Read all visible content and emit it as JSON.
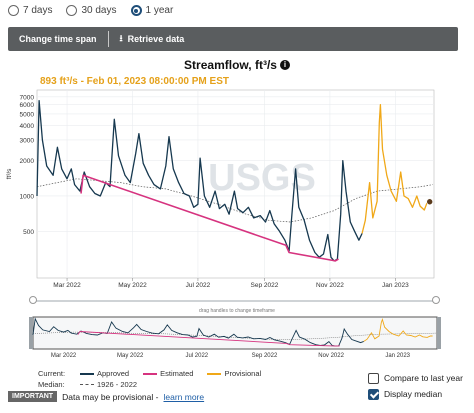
{
  "period_options": [
    {
      "label": "7 days",
      "selected": false
    },
    {
      "label": "30 days",
      "selected": false
    },
    {
      "label": "1 year",
      "selected": true
    }
  ],
  "toolbar": {
    "change_time_span": "Change time span",
    "retrieve_data": "Retrieve data"
  },
  "chart": {
    "title": "Streamflow, ft³/s",
    "readout": "893 ft³/s - Feb 01, 2023 08:00:00 PM EST"
  },
  "drag_hint": "drag handles to change timeframe",
  "legend": {
    "current_label": "Current:",
    "median_label": "Median:",
    "approved": "Approved",
    "estimated": "Estimated",
    "provisional": "Provisional",
    "median_range": "1926 - 2022"
  },
  "options": {
    "compare_label": "Compare to last year",
    "compare_checked": false,
    "median_label": "Display median",
    "median_checked": true
  },
  "notice": {
    "badge": "IMPORTANT",
    "text": "Data may be provisional -",
    "link": "learn more"
  },
  "colors": {
    "approved": "#16384f",
    "estimated": "#d6337f",
    "provisional": "#f0a818",
    "median": "#555555"
  },
  "watermark": {
    "text": "USGS"
  },
  "chart_data": {
    "type": "line",
    "title": "Streamflow, ft³/s",
    "ylabel": "ft³/s",
    "y_scale": "log",
    "ylim": [
      200,
      8000
    ],
    "y_ticks": [
      500,
      1000,
      2000,
      3000,
      4000,
      5000,
      6000,
      7000
    ],
    "x_ticks": [
      "Mar 2022",
      "May 2022",
      "Jul 2022",
      "Sep 2022",
      "Nov 2022",
      "Jan 2023"
    ],
    "x_ticks_iso": [
      "2022-03-01",
      "2022-05-01",
      "2022-07-01",
      "2022-09-01",
      "2022-11-01",
      "2023-01-01"
    ],
    "xlim": [
      "2022-02-01",
      "2023-02-06"
    ],
    "grid": true,
    "legend_position": "bottom-left",
    "series": [
      {
        "name": "Approved",
        "points": [
          [
            "2022-02-01",
            1000
          ],
          [
            "2022-02-03",
            6500
          ],
          [
            "2022-02-06",
            3000
          ],
          [
            "2022-02-10",
            1800
          ],
          [
            "2022-02-16",
            1500
          ],
          [
            "2022-02-20",
            2600
          ],
          [
            "2022-02-24",
            1700
          ],
          [
            "2022-03-01",
            1400
          ],
          [
            "2022-03-05",
            1700
          ],
          [
            "2022-03-08",
            1250
          ],
          [
            "2022-03-13",
            1100
          ],
          [
            "2022-03-17",
            1600
          ],
          [
            "2022-03-22",
            1200
          ],
          [
            "2022-03-27",
            1050
          ],
          [
            "2022-04-01",
            1000
          ],
          [
            "2022-04-06",
            1300
          ],
          [
            "2022-04-10",
            1200
          ],
          [
            "2022-04-14",
            4500
          ],
          [
            "2022-04-18",
            2200
          ],
          [
            "2022-04-24",
            1500
          ],
          [
            "2022-04-29",
            1300
          ],
          [
            "2022-05-04",
            2300
          ],
          [
            "2022-05-07",
            3400
          ],
          [
            "2022-05-11",
            1900
          ],
          [
            "2022-05-16",
            1500
          ],
          [
            "2022-05-21",
            1250
          ],
          [
            "2022-05-27",
            1150
          ],
          [
            "2022-06-01",
            1800
          ],
          [
            "2022-06-04",
            3200
          ],
          [
            "2022-06-08",
            1700
          ],
          [
            "2022-06-13",
            1300
          ],
          [
            "2022-06-18",
            1050
          ],
          [
            "2022-06-23",
            1000
          ],
          [
            "2022-06-27",
            800
          ],
          [
            "2022-07-01",
            850
          ],
          [
            "2022-07-03",
            2100
          ],
          [
            "2022-07-07",
            1000
          ],
          [
            "2022-07-12",
            800
          ],
          [
            "2022-07-17",
            1100
          ],
          [
            "2022-07-21",
            780
          ],
          [
            "2022-07-26",
            850
          ],
          [
            "2022-07-30",
            700
          ],
          [
            "2022-08-04",
            1100
          ],
          [
            "2022-08-07",
            780
          ],
          [
            "2022-08-12",
            720
          ],
          [
            "2022-08-17",
            800
          ],
          [
            "2022-08-22",
            650
          ],
          [
            "2022-08-28",
            680
          ],
          [
            "2022-09-02",
            600
          ],
          [
            "2022-09-06",
            750
          ],
          [
            "2022-09-10",
            580
          ],
          [
            "2022-09-15",
            500
          ],
          [
            "2022-09-20",
            420
          ],
          [
            "2022-09-24",
            340
          ],
          [
            "2022-09-26",
            600
          ],
          [
            "2022-09-30",
            1700
          ],
          [
            "2022-10-03",
            800
          ],
          [
            "2022-10-08",
            620
          ],
          [
            "2022-10-13",
            420
          ],
          [
            "2022-10-18",
            330
          ],
          [
            "2022-10-22",
            300
          ],
          [
            "2022-10-26",
            320
          ],
          [
            "2022-10-30",
            470
          ],
          [
            "2022-11-02",
            300
          ],
          [
            "2022-11-05",
            280
          ],
          [
            "2022-11-08",
            290
          ],
          [
            "2022-11-11",
            700
          ],
          [
            "2022-11-13",
            2000
          ],
          [
            "2022-11-16",
            1100
          ],
          [
            "2022-11-20",
            600
          ],
          [
            "2022-11-24",
            500
          ],
          [
            "2022-11-28",
            420
          ],
          [
            "2022-12-01",
            480
          ]
        ]
      },
      {
        "name": "Estimated",
        "points": [
          [
            "2022-03-14",
            1050
          ],
          [
            "2022-03-16",
            1500
          ],
          [
            "2022-09-21",
            380
          ],
          [
            "2022-09-24",
            330
          ],
          [
            "2022-11-06",
            280
          ],
          [
            "2022-11-09",
            290
          ]
        ]
      },
      {
        "name": "Provisional",
        "points": [
          [
            "2022-12-01",
            480
          ],
          [
            "2022-12-04",
            620
          ],
          [
            "2022-12-08",
            1300
          ],
          [
            "2022-12-11",
            650
          ],
          [
            "2022-12-15",
            900
          ],
          [
            "2022-12-17",
            4200
          ],
          [
            "2022-12-18",
            6000
          ],
          [
            "2022-12-20",
            2500
          ],
          [
            "2022-12-24",
            1500
          ],
          [
            "2022-12-28",
            1100
          ],
          [
            "2023-01-02",
            900
          ],
          [
            "2023-01-06",
            1600
          ],
          [
            "2023-01-09",
            1000
          ],
          [
            "2023-01-13",
            950
          ],
          [
            "2023-01-17",
            800
          ],
          [
            "2023-01-21",
            1000
          ],
          [
            "2023-01-24",
            820
          ],
          [
            "2023-01-28",
            760
          ],
          [
            "2023-01-31",
            900
          ],
          [
            "2023-02-02",
            893
          ]
        ]
      },
      {
        "name": "Median 1926 - 2022",
        "points": [
          [
            "2022-02-01",
            1200
          ],
          [
            "2022-02-20",
            1300
          ],
          [
            "2022-03-10",
            1400
          ],
          [
            "2022-03-31",
            1350
          ],
          [
            "2022-04-20",
            1300
          ],
          [
            "2022-05-10",
            1200
          ],
          [
            "2022-06-01",
            1150
          ],
          [
            "2022-06-25",
            1000
          ],
          [
            "2022-07-20",
            850
          ],
          [
            "2022-08-15",
            700
          ],
          [
            "2022-09-05",
            620
          ],
          [
            "2022-09-25",
            600
          ],
          [
            "2022-10-15",
            650
          ],
          [
            "2022-11-05",
            750
          ],
          [
            "2022-11-25",
            950
          ],
          [
            "2022-12-15",
            1100
          ],
          [
            "2023-01-05",
            1150
          ],
          [
            "2023-01-25",
            1200
          ],
          [
            "2023-02-05",
            1250
          ]
        ]
      }
    ],
    "current_point": {
      "date": "2023-02-02",
      "value": 893
    }
  }
}
